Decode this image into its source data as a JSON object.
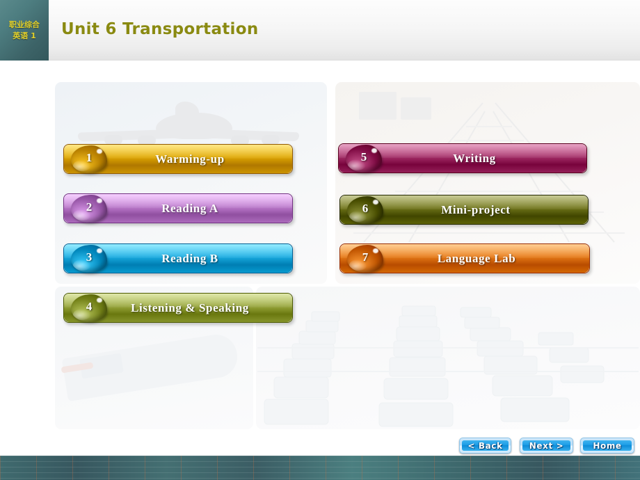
{
  "header": {
    "logo_line1": "职业综合",
    "logo_line2": "英语 1",
    "title": "Unit 6 Transportation"
  },
  "menu": {
    "left_items": [
      {
        "number": "1",
        "label": "Warming-up",
        "color": "#e0a800"
      },
      {
        "number": "2",
        "label": "Reading A",
        "color": "#c07fd0"
      },
      {
        "number": "3",
        "label": "Reading B",
        "color": "#1aaee3"
      },
      {
        "number": "4",
        "label": "Listening  &  Speaking",
        "color": "#9aa83f"
      }
    ],
    "right_items": [
      {
        "number": "5",
        "label": "Writing",
        "color": "#a8336c"
      },
      {
        "number": "6",
        "label": "Mini-project",
        "color": "#71761a"
      },
      {
        "number": "7",
        "label": "Language  Lab",
        "color": "#e87c17"
      }
    ]
  },
  "nav": {
    "back": "< Back",
    "next": "Next >",
    "home": "Home"
  },
  "watermarks": {
    "top_left": "airplane-watermark",
    "top_right": "railway-track-watermark",
    "bottom_left": "cargo-barge-watermark",
    "bottom_right": "traffic-jam-watermark"
  },
  "theme": {
    "logo_bg": "#43696d",
    "title_color": "#8a8a11",
    "footer_bg": "#3f6a6e",
    "nav_blue": "#1f9fe8"
  }
}
